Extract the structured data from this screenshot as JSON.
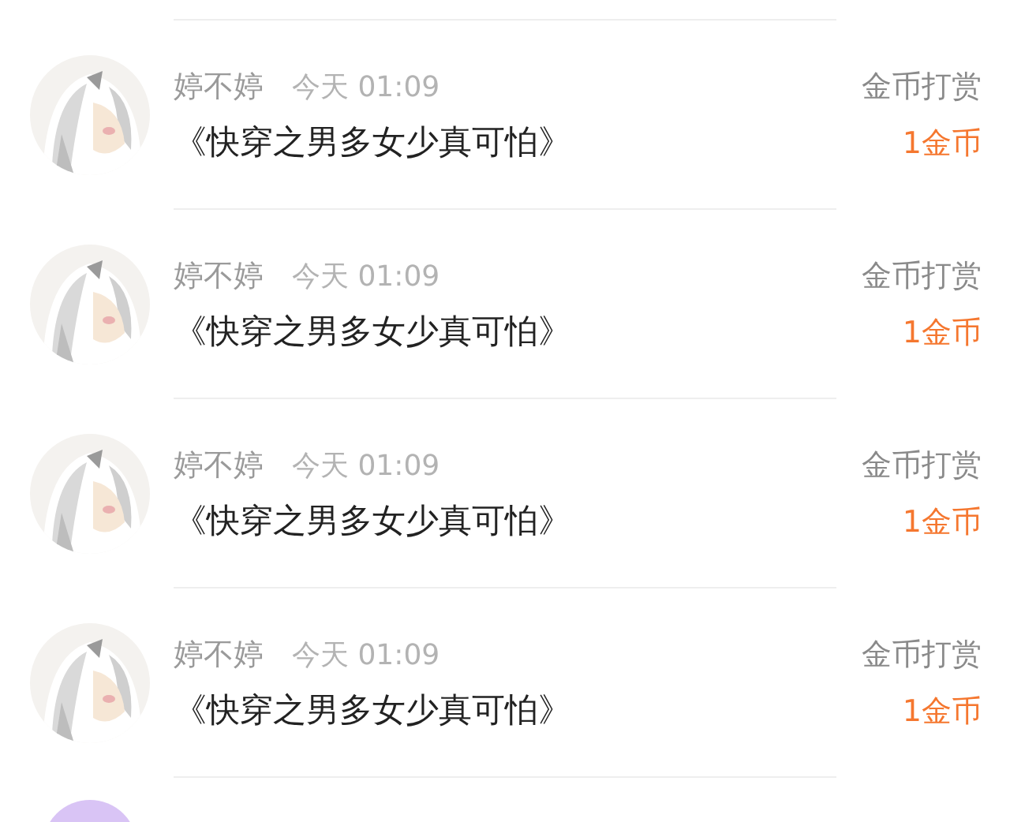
{
  "records": [
    {
      "name": "婷不婷",
      "time": "今天 01:09",
      "book": "《快穿之男多女少真可怕》",
      "type": "金币打赏",
      "amount": "1金币"
    },
    {
      "name": "婷不婷",
      "time": "今天 01:09",
      "book": "《快穿之男多女少真可怕》",
      "type": "金币打赏",
      "amount": "1金币"
    },
    {
      "name": "婷不婷",
      "time": "今天 01:09",
      "book": "《快穿之男多女少真可怕》",
      "type": "金币打赏",
      "amount": "1金币"
    },
    {
      "name": "婷不婷",
      "time": "今天 01:09",
      "book": "《快穿之男多女少真可怕》",
      "type": "金币打赏",
      "amount": "1金币"
    }
  ],
  "more_below": true
}
